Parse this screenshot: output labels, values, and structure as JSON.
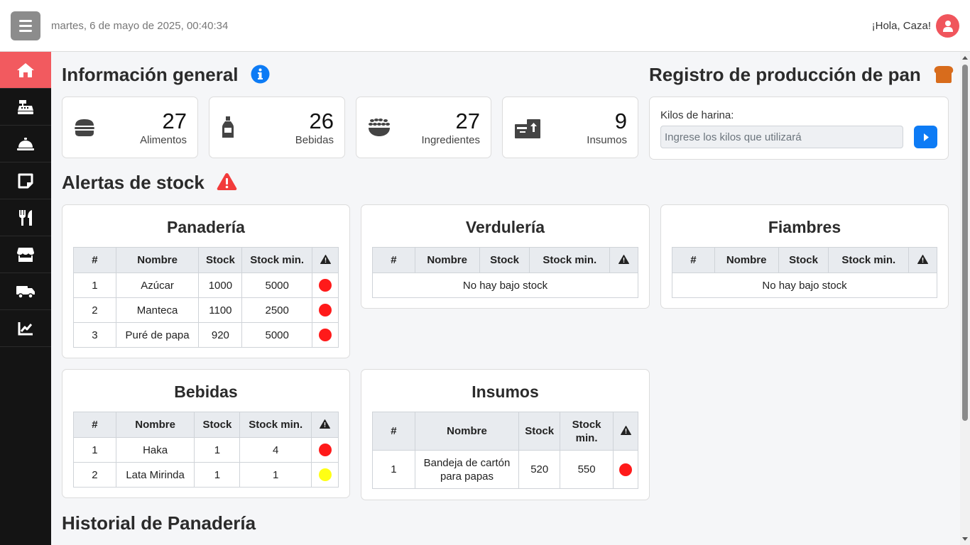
{
  "header": {
    "datetime": "martes, 6 de mayo de 2025, 00:40:34",
    "greeting": "¡Hola, Caza!"
  },
  "sidebar": {
    "items": [
      {
        "name": "home",
        "icon": "home-icon",
        "active": true
      },
      {
        "name": "cash-register",
        "icon": "cash-register-icon"
      },
      {
        "name": "service-bell",
        "icon": "bell-concierge-icon"
      },
      {
        "name": "notes",
        "icon": "sticky-note-icon"
      },
      {
        "name": "utensils",
        "icon": "utensils-icon"
      },
      {
        "name": "store",
        "icon": "store-icon"
      },
      {
        "name": "delivery",
        "icon": "truck-icon"
      },
      {
        "name": "stats",
        "icon": "chart-line-icon"
      }
    ]
  },
  "general": {
    "title": "Información general",
    "stats": [
      {
        "value": "27",
        "label": "Alimentos",
        "icon": "burger-icon"
      },
      {
        "value": "26",
        "label": "Bebidas",
        "icon": "bottle-icon"
      },
      {
        "value": "27",
        "label": "Ingredientes",
        "icon": "wheat-bowl-icon"
      },
      {
        "value": "9",
        "label": "Insumos",
        "icon": "boxes-icon"
      }
    ]
  },
  "production": {
    "title": "Registro de producción de pan",
    "kilos_label": "Kilos de harina:",
    "kilos_placeholder": "Ingrese los kilos que utilizará"
  },
  "alerts": {
    "title": "Alertas de stock",
    "columns": [
      "#",
      "Nombre",
      "Stock",
      "Stock min."
    ],
    "empty_text": "No hay bajo stock",
    "colors": {
      "red": "#ff1a1a",
      "yellow": "#ffff14"
    },
    "tables": {
      "panaderia": {
        "title": "Panadería",
        "rows": [
          {
            "n": "1",
            "nombre": "Azúcar",
            "stock": "1000",
            "min": "5000",
            "level": "red"
          },
          {
            "n": "2",
            "nombre": "Manteca",
            "stock": "1100",
            "min": "2500",
            "level": "red"
          },
          {
            "n": "3",
            "nombre": "Puré de papa",
            "stock": "920",
            "min": "5000",
            "level": "red"
          }
        ]
      },
      "verduleria": {
        "title": "Verdulería",
        "rows": []
      },
      "fiambres": {
        "title": "Fiambres",
        "rows": []
      },
      "bebidas": {
        "title": "Bebidas",
        "rows": [
          {
            "n": "1",
            "nombre": "Haka",
            "stock": "1",
            "min": "4",
            "level": "red"
          },
          {
            "n": "2",
            "nombre": "Lata Mirinda",
            "stock": "1",
            "min": "1",
            "level": "yellow"
          }
        ]
      },
      "insumos": {
        "title": "Insumos",
        "columns": [
          "#",
          "Nombre",
          "Stock",
          "Stock min."
        ],
        "rows": [
          {
            "n": "1",
            "nombre": "Bandeja de cartón para papas",
            "stock": "520",
            "min": "550",
            "level": "red"
          }
        ]
      }
    }
  },
  "history": {
    "title": "Historial de Panadería"
  }
}
